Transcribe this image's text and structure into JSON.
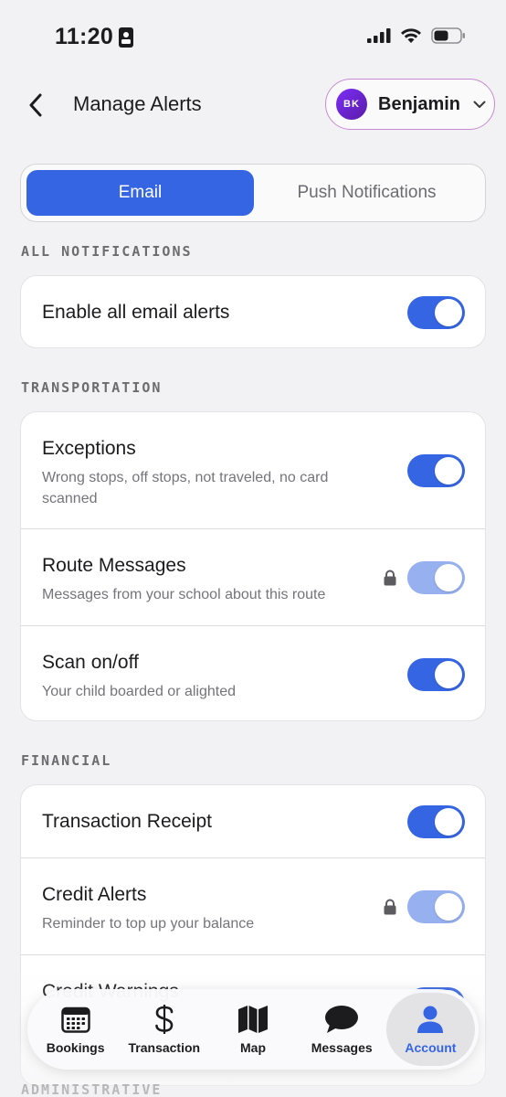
{
  "status": {
    "time": "11:20"
  },
  "header": {
    "title": "Manage Alerts",
    "profile_initials": "BK",
    "profile_name": "Benjamin"
  },
  "tabs": [
    {
      "label": "Email",
      "active": true
    },
    {
      "label": "Push Notifications",
      "active": false
    }
  ],
  "sections": {
    "all": {
      "title": "ALL NOTIFICATIONS",
      "rows": [
        {
          "title": "Enable all email alerts",
          "enabled": true,
          "locked": false
        }
      ]
    },
    "transportation": {
      "title": "TRANSPORTATION",
      "rows": [
        {
          "title": "Exceptions",
          "subtitle": "Wrong stops, off stops, not traveled, no card scanned",
          "enabled": true,
          "locked": false
        },
        {
          "title": "Route Messages",
          "subtitle": "Messages from your school about this route",
          "enabled": true,
          "locked": true
        },
        {
          "title": "Scan on/off",
          "subtitle": "Your child boarded or alighted",
          "enabled": true,
          "locked": false
        }
      ]
    },
    "financial": {
      "title": "FINANCIAL",
      "rows": [
        {
          "title": "Transaction Receipt",
          "enabled": true,
          "locked": false
        },
        {
          "title": "Credit Alerts",
          "subtitle": "Reminder to top up your balance",
          "enabled": true,
          "locked": true
        },
        {
          "title": "Credit Warnings",
          "enabled": true,
          "locked": false
        }
      ]
    },
    "administrative": {
      "title": "ADMINISTRATIVE"
    }
  },
  "nav": [
    {
      "label": "Bookings",
      "icon": "calendar-icon",
      "active": false
    },
    {
      "label": "Transaction",
      "icon": "dollar-icon",
      "active": false
    },
    {
      "label": "Map",
      "icon": "map-icon",
      "active": false
    },
    {
      "label": "Messages",
      "icon": "chat-bubble-icon",
      "active": false
    },
    {
      "label": "Account",
      "icon": "person-icon",
      "active": true
    }
  ],
  "colors": {
    "accent": "#3565e3",
    "accent_locked": "#97b0f0",
    "avatar": "#6a22c9"
  }
}
